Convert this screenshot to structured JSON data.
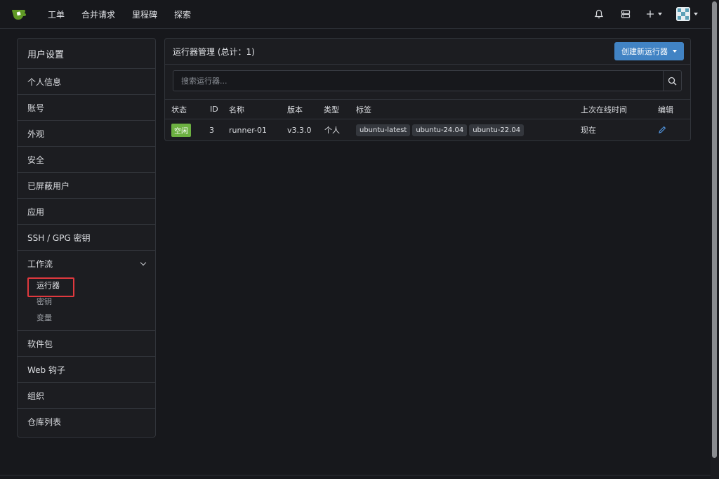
{
  "nav": {
    "items": [
      "工单",
      "合并请求",
      "里程碑",
      "探索"
    ]
  },
  "sidebar": {
    "header": "用户设置",
    "items_top": [
      "个人信息",
      "账号",
      "外观",
      "安全",
      "已屏蔽用户",
      "应用",
      "SSH / GPG 密钥"
    ],
    "group": {
      "label": "工作流",
      "subs": [
        "运行器",
        "密钥",
        "变量"
      ]
    },
    "items_bottom": [
      "软件包",
      "Web 钩子",
      "组织",
      "仓库列表"
    ]
  },
  "panel": {
    "title": "运行器管理 (总计：1)",
    "create_label": "创建新运行器",
    "search_placeholder": "搜索运行器..."
  },
  "table": {
    "headers": [
      "状态",
      "ID",
      "名称",
      "版本",
      "类型",
      "标签",
      "上次在线时间",
      "编辑"
    ],
    "rows": [
      {
        "status": "空闲",
        "id": "3",
        "name": "runner-01",
        "version": "v3.3.0",
        "type": "个人",
        "labels": [
          "ubuntu-latest",
          "ubuntu-24.04",
          "ubuntu-22.04"
        ],
        "last_online": "现在"
      }
    ]
  },
  "colors": {
    "accent": "#4183c4",
    "status_idle": "#6cb041",
    "highlight": "#e0393e"
  },
  "icons": {
    "logo": "gitea-logo-icon",
    "notifications": "bell-icon",
    "stopwatch": "server-icon",
    "create": "plus-icon",
    "search": "search-icon",
    "edit": "pencil-icon"
  }
}
